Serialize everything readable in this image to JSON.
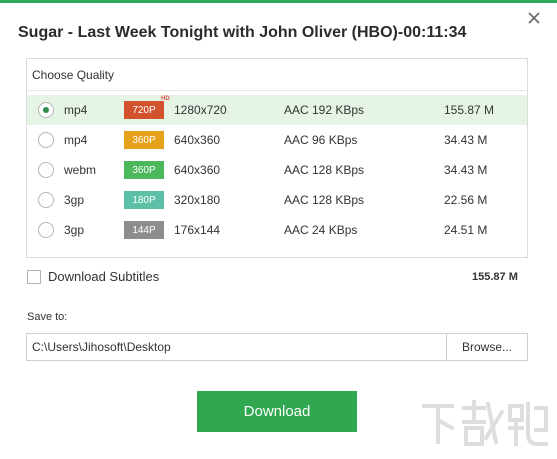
{
  "dialog": {
    "title": "Sugar - Last Week Tonight with John Oliver (HBO)-00:11:34"
  },
  "quality": {
    "header": "Choose Quality",
    "options": [
      {
        "format": "mp4",
        "badge": "720P",
        "badge_color": "#d2522e",
        "hd": "HD",
        "resolution": "1280x720",
        "audio": "AAC 192 KBps",
        "size": "155.87 M",
        "selected": true
      },
      {
        "format": "mp4",
        "badge": "360P",
        "badge_color": "#e6a11a",
        "resolution": "640x360",
        "audio": "AAC 96 KBps",
        "size": "34.43 M",
        "selected": false
      },
      {
        "format": "webm",
        "badge": "360P",
        "badge_color": "#4cb85c",
        "resolution": "640x360",
        "audio": "AAC 128 KBps",
        "size": "34.43 M",
        "selected": false
      },
      {
        "format": "3gp",
        "badge": "180P",
        "badge_color": "#5cc0a6",
        "resolution": "320x180",
        "audio": "AAC 128 KBps",
        "size": "22.56 M",
        "selected": false
      },
      {
        "format": "3gp",
        "badge": "144P",
        "badge_color": "#8d8d8d",
        "resolution": "176x144",
        "audio": "AAC 24 KBps",
        "size": "24.51 M",
        "selected": false
      }
    ]
  },
  "subtitles": {
    "label": "Download Subtitles",
    "checked": false
  },
  "total_size": "155.87 M",
  "save": {
    "label": "Save to:",
    "path": "C:\\Users\\Jihosoft\\Desktop",
    "browse_label": "Browse..."
  },
  "download_label": "Download",
  "colors": {
    "accent": "#2fa84f",
    "selected_row": "#e6f4e6"
  }
}
